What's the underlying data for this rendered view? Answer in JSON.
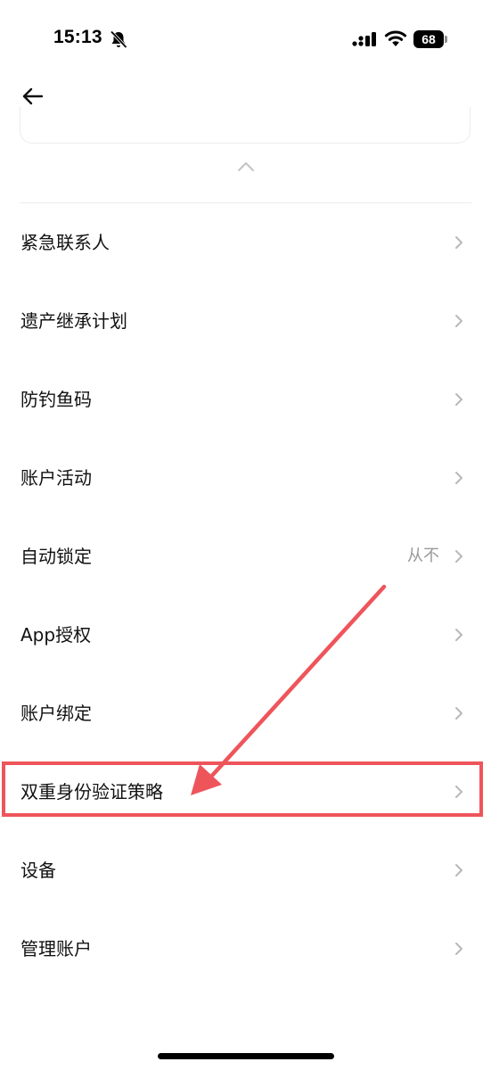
{
  "status_bar": {
    "time": "15:13",
    "battery": "68"
  },
  "settings": {
    "items": [
      {
        "label": "紧急联系人",
        "value": ""
      },
      {
        "label": "遗产继承计划",
        "value": ""
      },
      {
        "label": "防钓鱼码",
        "value": ""
      },
      {
        "label": "账户活动",
        "value": ""
      },
      {
        "label": "自动锁定",
        "value": "从不"
      },
      {
        "label": "App授权",
        "value": ""
      },
      {
        "label": "账户绑定",
        "value": ""
      },
      {
        "label": "双重身份验证策略",
        "value": ""
      },
      {
        "label": "设备",
        "value": ""
      },
      {
        "label": "管理账户",
        "value": ""
      }
    ]
  },
  "icons": {
    "back": "back-arrow-icon",
    "collapse": "chevron-up-icon",
    "row_chevron": "chevron-right-icon",
    "bell": "bell-off-icon",
    "signal": "signal-icon",
    "wifi": "wifi-icon"
  },
  "colors": {
    "annotation": "#ee555b",
    "value_text": "#9a9a9a",
    "chevron": "#b8b8b8"
  },
  "annotation": {
    "highlighted_item": "双重身份验证策略"
  }
}
